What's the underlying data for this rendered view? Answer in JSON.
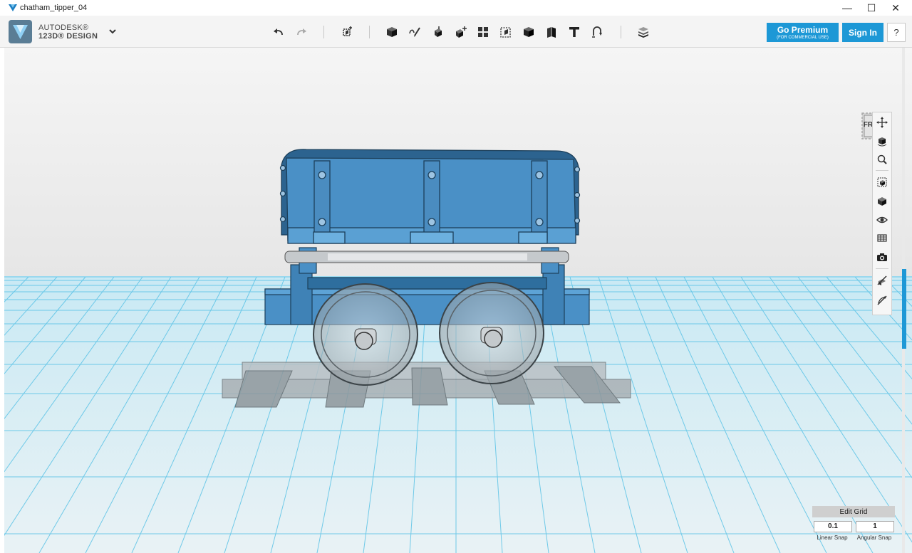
{
  "window": {
    "title": "chatham_tipper_04",
    "minimize_glyph": "—",
    "maximize_glyph": "☐",
    "close_glyph": "✕"
  },
  "brand": {
    "line1": "AUTODESK®",
    "line2": "123D® DESIGN"
  },
  "toolbar": {
    "undo_icon": "undo-arrow-icon",
    "redo_icon": "redo-arrow-icon",
    "tools": [
      "transform-icon",
      "primitives-icon",
      "sketch-icon",
      "construct-icon",
      "modify-icon",
      "pattern-icon",
      "group-icon",
      "combine-icon",
      "measure-icon",
      "text-icon",
      "snap-icon",
      "material-icon"
    ]
  },
  "account": {
    "premium_label": "Go Premium",
    "premium_sub": "(FOR COMMERCIAL USE)",
    "signin_label": "Sign In",
    "help_label": "?"
  },
  "viewcube": {
    "face_label": "FRONT"
  },
  "nav_tools": [
    "pan-icon",
    "orbit-icon",
    "zoom-icon",
    "fit-icon",
    "perspective-icon",
    "visibility-icon",
    "materials-outlines-icon",
    "camera-icon",
    "show-hide-sketch-icon",
    "show-hide-mesh-icon"
  ],
  "grid": {
    "edit_label": "Edit Grid",
    "linear_snap_value": "0.1",
    "angular_snap_value": "1",
    "linear_snap_label": "Linear Snap",
    "angular_snap_label": "Angular Snap"
  },
  "colors": {
    "accent": "#1d98d6",
    "model_blue": "#4a90c6",
    "grid_line": "#5bc3e6",
    "floor": "#dfeef3"
  }
}
